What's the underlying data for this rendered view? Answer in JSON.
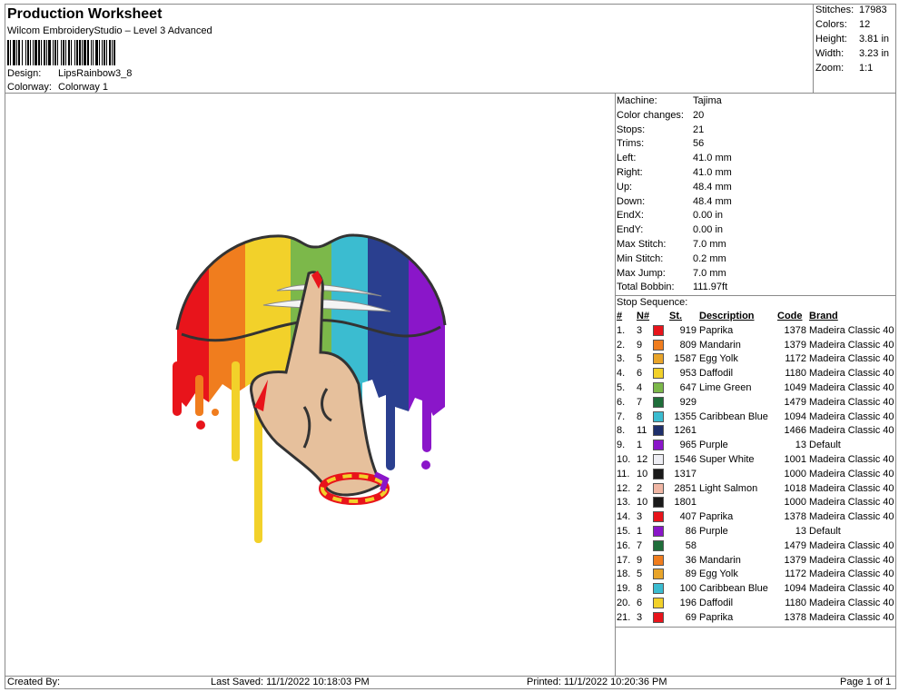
{
  "header": {
    "title": "Production Worksheet",
    "software": "Wilcom EmbroideryStudio – Level 3 Advanced",
    "design_label": "Design:",
    "design_value": "LipsRainbow3_8",
    "colorway_label": "Colorway:",
    "colorway_value": "Colorway 1"
  },
  "summary": [
    {
      "label": "Stitches:",
      "value": "17983"
    },
    {
      "label": "Colors:",
      "value": "12"
    },
    {
      "label": "Height:",
      "value": "3.81 in"
    },
    {
      "label": "Width:",
      "value": "3.23 in"
    },
    {
      "label": "Zoom:",
      "value": "1:1"
    }
  ],
  "params": [
    {
      "label": "Machine:",
      "value": "Tajima"
    },
    {
      "label": "Color changes:",
      "value": "20"
    },
    {
      "label": "Stops:",
      "value": "21"
    },
    {
      "label": "Trims:",
      "value": "56"
    },
    {
      "label": "Left:",
      "value": "41.0 mm"
    },
    {
      "label": "Right:",
      "value": "41.0 mm"
    },
    {
      "label": "Up:",
      "value": "48.4 mm"
    },
    {
      "label": "Down:",
      "value": "48.4 mm"
    },
    {
      "label": "EndX:",
      "value": "0.00 in"
    },
    {
      "label": "EndY:",
      "value": "0.00 in"
    },
    {
      "label": "Max Stitch:",
      "value": "7.0 mm"
    },
    {
      "label": "Min Stitch:",
      "value": "0.2 mm"
    },
    {
      "label": "Max Jump:",
      "value": "7.0 mm"
    },
    {
      "label": "Total Bobbin:",
      "value": "111.97ft"
    }
  ],
  "stop_sequence": {
    "title": "Stop Sequence:",
    "columns": {
      "seq": "#",
      "n": "N#",
      "st": "St.",
      "desc": "Description",
      "code": "Code",
      "brand": "Brand"
    },
    "rows": [
      {
        "seq": "1.",
        "n": "3",
        "color": "#e8141b",
        "st": "919",
        "desc": "Paprika",
        "code": "1378",
        "brand": "Madeira Classic 40"
      },
      {
        "seq": "2.",
        "n": "9",
        "color": "#f07d1e",
        "st": "809",
        "desc": "Mandarin",
        "code": "1379",
        "brand": "Madeira Classic 40"
      },
      {
        "seq": "3.",
        "n": "5",
        "color": "#e8a42a",
        "st": "1587",
        "desc": "Egg Yolk",
        "code": "1172",
        "brand": "Madeira Classic 40"
      },
      {
        "seq": "4.",
        "n": "6",
        "color": "#f2d12a",
        "st": "953",
        "desc": "Daffodil",
        "code": "1180",
        "brand": "Madeira Classic 40"
      },
      {
        "seq": "5.",
        "n": "4",
        "color": "#7cb84a",
        "st": "647",
        "desc": "Lime Green",
        "code": "1049",
        "brand": "Madeira Classic 40"
      },
      {
        "seq": "6.",
        "n": "7",
        "color": "#1f6e3a",
        "st": "929",
        "desc": "",
        "code": "1479",
        "brand": "Madeira Classic 40"
      },
      {
        "seq": "7.",
        "n": "8",
        "color": "#3bbcd0",
        "st": "1355",
        "desc": "Caribbean Blue",
        "code": "1094",
        "brand": "Madeira Classic 40"
      },
      {
        "seq": "8.",
        "n": "11",
        "color": "#1e2f6b",
        "st": "1261",
        "desc": "",
        "code": "1466",
        "brand": "Madeira Classic 40"
      },
      {
        "seq": "9.",
        "n": "1",
        "color": "#8a16c9",
        "st": "965",
        "desc": "Purple",
        "code": "13",
        "brand": "Default"
      },
      {
        "seq": "10.",
        "n": "12",
        "color": "#eeeef4",
        "st": "1546",
        "desc": "Super White",
        "code": "1001",
        "brand": "Madeira Classic 40"
      },
      {
        "seq": "11.",
        "n": "10",
        "color": "#1a1a1a",
        "st": "1317",
        "desc": "",
        "code": "1000",
        "brand": "Madeira Classic 40"
      },
      {
        "seq": "12.",
        "n": "2",
        "color": "#f0b6a4",
        "st": "2851",
        "desc": "Light Salmon",
        "code": "1018",
        "brand": "Madeira Classic 40"
      },
      {
        "seq": "13.",
        "n": "10",
        "color": "#1a1a1a",
        "st": "1801",
        "desc": "",
        "code": "1000",
        "brand": "Madeira Classic 40"
      },
      {
        "seq": "14.",
        "n": "3",
        "color": "#e8141b",
        "st": "407",
        "desc": "Paprika",
        "code": "1378",
        "brand": "Madeira Classic 40"
      },
      {
        "seq": "15.",
        "n": "1",
        "color": "#8a16c9",
        "st": "86",
        "desc": "Purple",
        "code": "13",
        "brand": "Default"
      },
      {
        "seq": "16.",
        "n": "7",
        "color": "#1f6e3a",
        "st": "58",
        "desc": "",
        "code": "1479",
        "brand": "Madeira Classic 40"
      },
      {
        "seq": "17.",
        "n": "9",
        "color": "#f07d1e",
        "st": "36",
        "desc": "Mandarin",
        "code": "1379",
        "brand": "Madeira Classic 40"
      },
      {
        "seq": "18.",
        "n": "5",
        "color": "#e8a42a",
        "st": "89",
        "desc": "Egg Yolk",
        "code": "1172",
        "brand": "Madeira Classic 40"
      },
      {
        "seq": "19.",
        "n": "8",
        "color": "#3bbcd0",
        "st": "100",
        "desc": "Caribbean Blue",
        "code": "1094",
        "brand": "Madeira Classic 40"
      },
      {
        "seq": "20.",
        "n": "6",
        "color": "#f2d12a",
        "st": "196",
        "desc": "Daffodil",
        "code": "1180",
        "brand": "Madeira Classic 40"
      },
      {
        "seq": "21.",
        "n": "3",
        "color": "#e8141b",
        "st": "69",
        "desc": "Paprika",
        "code": "1378",
        "brand": "Madeira Classic 40"
      }
    ]
  },
  "footer": {
    "created": "Created By:",
    "saved": "Last Saved: 11/1/2022 10:18:03 PM",
    "printed": "Printed: 11/1/2022 10:20:36 PM",
    "page": "Page 1 of 1"
  }
}
